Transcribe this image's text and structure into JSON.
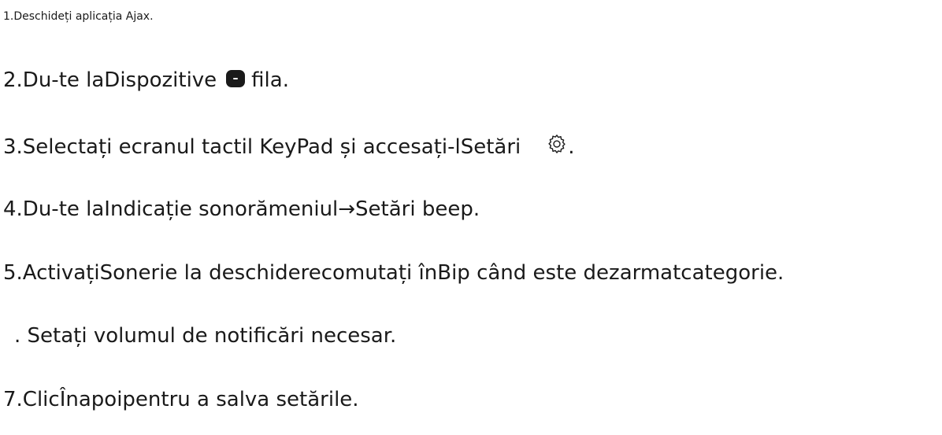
{
  "steps": [
    {
      "text": "1.Deschideți aplicația Ajax."
    },
    {
      "before": "2.Du-te laDispozitive",
      "icon": "devices-tab-icon",
      "after": "fila."
    },
    {
      "before": "3.Selectați ecranul tactil KeyPad și accesați-lSetări",
      "icon": "gear-icon",
      "after": "."
    },
    {
      "text": "4.Du-te laIndicație sonorămeniul→Setări beep."
    },
    {
      "text": "5.ActivațiSonerie la deschiderecomutați înBip când este dezarmatcategorie."
    },
    {
      "text": ". Setați volumul de notificări necesar."
    },
    {
      "text": "7.ClicÎnapoipentru a salva setările."
    }
  ]
}
